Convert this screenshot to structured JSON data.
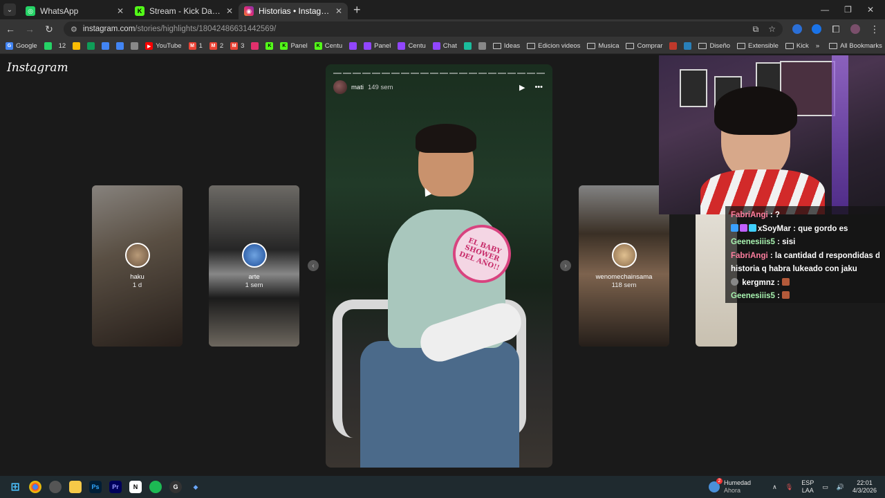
{
  "tabs": [
    {
      "label": "WhatsApp",
      "icon": "whatsapp-icon",
      "color": "#25d366"
    },
    {
      "label": "Stream - Kick Dashboard",
      "icon": "kick-icon",
      "color": "#53fc18"
    },
    {
      "label": "Historias • Instagram",
      "icon": "instagram-icon",
      "color": "#e1306c",
      "active": true
    }
  ],
  "address": {
    "host": "instagram.com",
    "path": "/stories/highlights/18042486631442569/"
  },
  "bookmarks": [
    {
      "label": "Google",
      "icon": "google-icon",
      "color": "#4285f4"
    },
    {
      "label": "",
      "icon": "whatsapp-icon",
      "color": "#25d366"
    },
    {
      "label": "12",
      "icon": "",
      "color": ""
    },
    {
      "label": "",
      "icon": "drive-icon",
      "color": "#fbbc04"
    },
    {
      "label": "",
      "icon": "sheets-icon",
      "color": "#0f9d58"
    },
    {
      "label": "",
      "icon": "docs-icon",
      "color": "#4285f4"
    },
    {
      "label": "",
      "icon": "calendar-icon",
      "color": "#4285f4"
    },
    {
      "label": "",
      "icon": "instagram-icon",
      "color": "#888"
    },
    {
      "label": "YouTube",
      "icon": "youtube-icon",
      "color": "#ff0000"
    },
    {
      "label": "1",
      "icon": "gmail-icon",
      "color": "#ea4335"
    },
    {
      "label": "2",
      "icon": "gmail-icon",
      "color": "#ea4335"
    },
    {
      "label": "3",
      "icon": "gmail-icon",
      "color": "#ea4335"
    },
    {
      "label": "",
      "icon": "instagram-icon",
      "color": "#e1306c"
    },
    {
      "label": "",
      "icon": "kick-icon",
      "color": "#53fc18"
    },
    {
      "label": "Panel",
      "icon": "kick-icon",
      "color": "#53fc18"
    },
    {
      "label": "Centu",
      "icon": "kick-icon",
      "color": "#53fc18"
    },
    {
      "label": "",
      "icon": "twitch-icon",
      "color": "#9146ff"
    },
    {
      "label": "Panel",
      "icon": "twitch-icon",
      "color": "#9146ff"
    },
    {
      "label": "Centu",
      "icon": "twitch-icon",
      "color": "#9146ff"
    },
    {
      "label": "Chat",
      "icon": "twitch-icon",
      "color": "#9146ff"
    },
    {
      "label": "",
      "icon": "app-icon",
      "color": "#1abc9c"
    },
    {
      "label": "",
      "icon": "discord-icon",
      "color": "#888"
    },
    {
      "label": "Ideas",
      "icon": "folder-icon",
      "color": ""
    },
    {
      "label": "Edicion videos",
      "icon": "folder-icon",
      "color": ""
    },
    {
      "label": "Musica",
      "icon": "folder-icon",
      "color": ""
    },
    {
      "label": "Comprar",
      "icon": "folder-icon",
      "color": ""
    },
    {
      "label": "",
      "icon": "app-icon",
      "color": "#c0392b"
    },
    {
      "label": "",
      "icon": "app-icon",
      "color": "#2980b9"
    },
    {
      "label": "Diseño",
      "icon": "folder-icon",
      "color": ""
    },
    {
      "label": "Extensible",
      "icon": "folder-icon",
      "color": ""
    },
    {
      "label": "Kick",
      "icon": "folder-icon",
      "color": ""
    }
  ],
  "all_bookmarks": "All Bookmarks",
  "instagram": {
    "logo": "Instagram",
    "side_stories": [
      {
        "name": "haku",
        "time": "1 d"
      },
      {
        "name": "arte",
        "time": "1 sem"
      },
      {
        "name": "wenomechainsama",
        "time": "118 sem"
      }
    ],
    "story": {
      "user": "mati",
      "time": "149 sem",
      "segments": 22,
      "sign_text": "EL BABY SHOWER DEL AÑO!!"
    }
  },
  "chat": [
    {
      "user": "FabriAngi",
      "msg": ": ?",
      "color": "#ff7fa0"
    },
    {
      "user": "xSoyMar",
      "msg": ": que gordo es",
      "color": "#ffffff",
      "badges": true
    },
    {
      "user": "Geenesiiis5",
      "msg": ": sisi",
      "color": "#a8f3b0"
    },
    {
      "user": "FabriAngi",
      "msg": ": la cantidad d respondidas d",
      "color": "#ff7fa0"
    },
    {
      "user": "",
      "msg": "historia q habra lukeado con jaku",
      "color": "#ffffff"
    },
    {
      "user": "kergmnz",
      "msg": ":",
      "color": "#ffffff",
      "emote": true
    },
    {
      "user": "Geenesiiis5",
      "msg": ":",
      "color": "#a8f3b0",
      "emote": true
    }
  ],
  "taskbar": {
    "weather_title": "Humedad",
    "weather_sub": "Ahora",
    "weather_badge": "2",
    "lang_top": "ESP",
    "lang_bottom": "LAA",
    "time": "22:01",
    "date": "4/3/2026"
  }
}
